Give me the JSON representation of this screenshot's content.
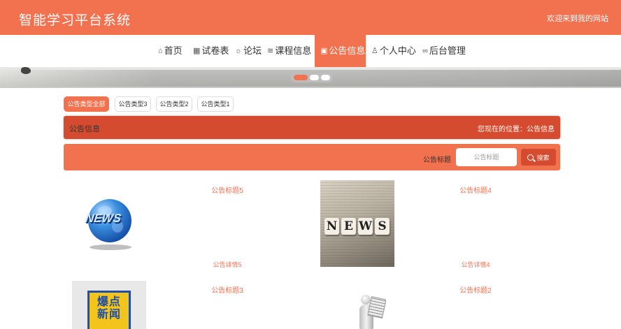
{
  "header": {
    "title": "智能学习平台系统",
    "welcome": "欢迎来到我的网站",
    "bg_color": "#f2714f"
  },
  "nav": {
    "items": [
      {
        "icon": "home-icon",
        "glyph": "⌂",
        "label": "首页"
      },
      {
        "icon": "exam-icon",
        "glyph": "▦",
        "label": "试卷表"
      },
      {
        "icon": "forum-icon",
        "glyph": "☼",
        "label": "论坛"
      },
      {
        "icon": "course-icon",
        "glyph": "≋",
        "label": "课程信息"
      },
      {
        "icon": "notice-icon",
        "glyph": "▣",
        "label": "公告信息",
        "active": true
      },
      {
        "icon": "user-icon",
        "glyph": "♙",
        "label": "个人中心"
      },
      {
        "icon": "link-icon",
        "glyph": "∞",
        "label": "后台管理"
      }
    ]
  },
  "banner": {
    "active_slide": 1,
    "slide_count": 3
  },
  "notice_types": [
    {
      "label": "公告类型全部",
      "active": true
    },
    {
      "label": "公告类型3"
    },
    {
      "label": "公告类型2"
    },
    {
      "label": "公告类型1"
    }
  ],
  "section": {
    "title": "公告信息",
    "location": "您现在的位置：公告信息"
  },
  "search": {
    "label": "公告标题",
    "placeholder": "公告标题",
    "button": "搜索"
  },
  "cards": [
    {
      "title": "公告标题5",
      "detail": "公告详情5",
      "image": "news-globe-image"
    },
    {
      "title": "公告标题4",
      "detail": "公告详情4",
      "image": "news-cubes-image",
      "image_text": "NEWS"
    },
    {
      "title": "公告标题3",
      "image": "breaking-news-poster-image",
      "image_text": "爆点新闻"
    },
    {
      "title": "公告标题2",
      "image": "figure-reading-newspaper-image"
    }
  ],
  "colors": {
    "accent": "#f2714f",
    "section_bar": "#d54b2f",
    "link_text": "#f2714f"
  }
}
